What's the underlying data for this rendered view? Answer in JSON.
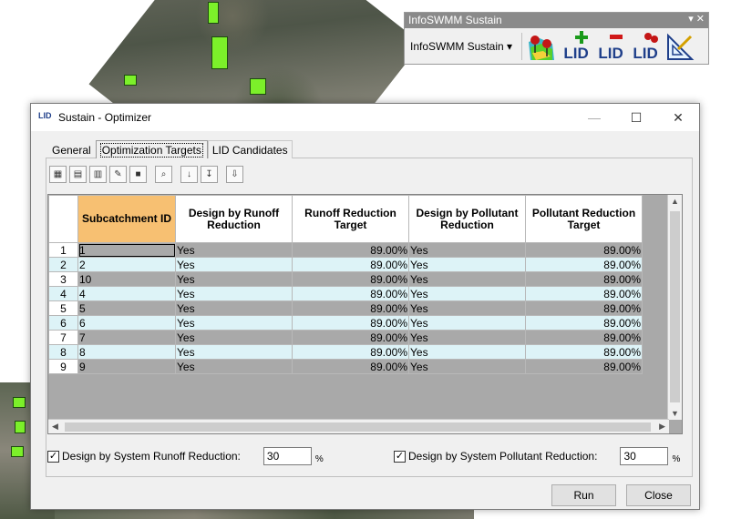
{
  "toolbar_window": {
    "title": "InfoSWMM Sustain",
    "controls": "▾ ✕",
    "dropdown_label": "InfoSWMM Sustain",
    "dropdown_arrow": "▾",
    "buttons": [
      {
        "name": "map-tool",
        "icon": "map-flag-icon"
      },
      {
        "name": "lid-add",
        "label": "LID",
        "icon": "plus-icon"
      },
      {
        "name": "lid-remove",
        "label": "LID",
        "icon": "minus-icon"
      },
      {
        "name": "lid-locate",
        "label": "LID",
        "icon": "locate-icon"
      },
      {
        "name": "optimizer",
        "icon": "triangle-ruler-icon"
      }
    ]
  },
  "dialog": {
    "icon_text": "LID",
    "title": "Sustain - Optimizer",
    "minimize": "—",
    "maximize": "☐",
    "close": "✕",
    "tabs": [
      "General",
      "Optimization Targets",
      "LID Candidates"
    ],
    "active_tab": "Optimization Targets",
    "grid": {
      "columns": [
        "Subcatchment ID",
        "Design by Runoff Reduction",
        "Runoff Reduction Target",
        "Design by Pollutant Reduction",
        "Pollutant Reduction Target"
      ],
      "rows": [
        {
          "n": "1",
          "id": "1",
          "runoff": "Yes",
          "runoff_target": "89.00%",
          "pollutant": "Yes",
          "pollutant_target": "89.00%"
        },
        {
          "n": "2",
          "id": "2",
          "runoff": "Yes",
          "runoff_target": "89.00%",
          "pollutant": "Yes",
          "pollutant_target": "89.00%"
        },
        {
          "n": "3",
          "id": "10",
          "runoff": "Yes",
          "runoff_target": "89.00%",
          "pollutant": "Yes",
          "pollutant_target": "89.00%"
        },
        {
          "n": "4",
          "id": "4",
          "runoff": "Yes",
          "runoff_target": "89.00%",
          "pollutant": "Yes",
          "pollutant_target": "89.00%"
        },
        {
          "n": "5",
          "id": "5",
          "runoff": "Yes",
          "runoff_target": "89.00%",
          "pollutant": "Yes",
          "pollutant_target": "89.00%"
        },
        {
          "n": "6",
          "id": "6",
          "runoff": "Yes",
          "runoff_target": "89.00%",
          "pollutant": "Yes",
          "pollutant_target": "89.00%"
        },
        {
          "n": "7",
          "id": "7",
          "runoff": "Yes",
          "runoff_target": "89.00%",
          "pollutant": "Yes",
          "pollutant_target": "89.00%"
        },
        {
          "n": "8",
          "id": "8",
          "runoff": "Yes",
          "runoff_target": "89.00%",
          "pollutant": "Yes",
          "pollutant_target": "89.00%"
        },
        {
          "n": "9",
          "id": "9",
          "runoff": "Yes",
          "runoff_target": "89.00%",
          "pollutant": "Yes",
          "pollutant_target": "89.00%"
        }
      ]
    },
    "system_runoff": {
      "label": "Design by System Runoff Reduction:",
      "checked": "✓",
      "value": "30",
      "unit": "%"
    },
    "system_pollutant": {
      "label": "Design by System Pollutant Reduction:",
      "checked": "✓",
      "value": "30",
      "unit": "%"
    },
    "run_label": "Run",
    "close_label": "Close"
  }
}
